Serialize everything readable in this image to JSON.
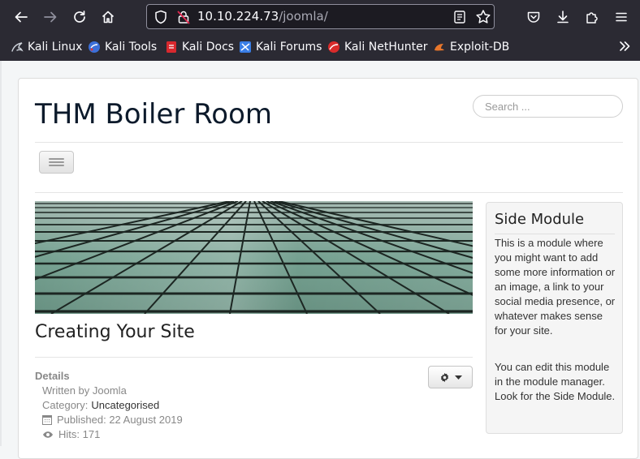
{
  "browser": {
    "url_host": "10.10.224.73",
    "url_path": "/joomla/",
    "bookmarks": [
      {
        "label": "Kali Linux",
        "icon": "kali-dragon-icon"
      },
      {
        "label": "Kali Tools",
        "icon": "kali-tools-icon"
      },
      {
        "label": "Kali Docs",
        "icon": "kali-docs-icon"
      },
      {
        "label": "Kali Forums",
        "icon": "kali-forums-icon"
      },
      {
        "label": "Kali NetHunter",
        "icon": "nethunter-icon"
      },
      {
        "label": "Exploit-DB",
        "icon": "exploit-db-icon"
      }
    ]
  },
  "site": {
    "title": "THM Boiler Room",
    "search_placeholder": "Search ..."
  },
  "article": {
    "title": "Creating Your Site",
    "details_label": "Details",
    "written_by": "Written by Joomla",
    "category_prefix": "Category: ",
    "category": "Uncategorised",
    "published": "Published: 22 August 2019",
    "hits": "Hits: 171"
  },
  "side_module": {
    "title": "Side Module",
    "p1": "This is a module where you might want to add some more information or an image, a link to your social media presence, or whatever makes sense for your site.",
    "p2": "You can edit this module in the module manager. Look for the Side Module."
  }
}
